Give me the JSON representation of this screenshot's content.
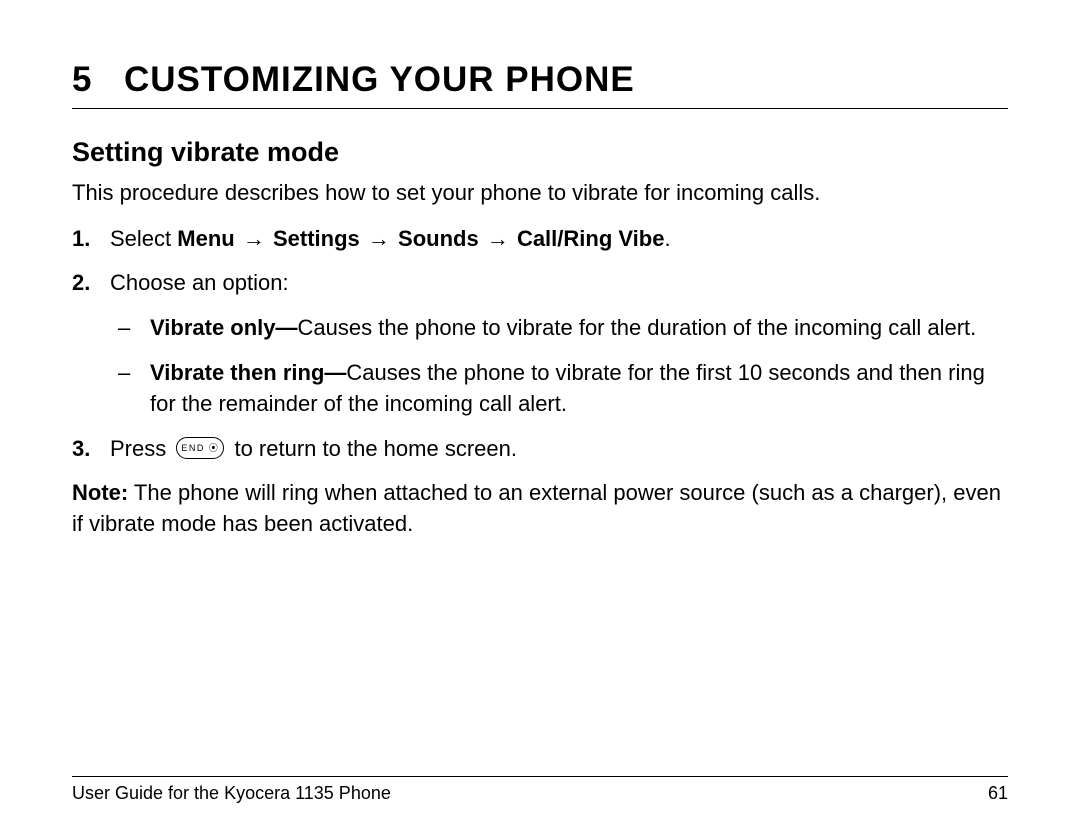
{
  "chapter": {
    "number": "5",
    "title": "CUSTOMIZING YOUR PHONE"
  },
  "section": {
    "title": "Setting vibrate mode",
    "intro": "This procedure describes how to set your phone to vibrate for incoming calls."
  },
  "steps": {
    "s1_prefix": "Select ",
    "s1_path_menu": "Menu",
    "s1_path_settings": "Settings",
    "s1_path_sounds": "Sounds",
    "s1_path_callring": "Call/Ring Vibe",
    "arrow": "→",
    "s1_suffix": ".",
    "s2_text": "Choose an option:",
    "s2_opt1_label": "Vibrate only—",
    "s2_opt1_text": "Causes the phone to vibrate for the duration of the incoming call alert.",
    "s2_opt2_label": "Vibrate then ring—",
    "s2_opt2_text": "Causes the phone to vibrate for the first 10 seconds and then ring for the remainder of the incoming call alert.",
    "s3_prefix": "Press ",
    "s3_key": "END",
    "s3_key_symbol": "⦿",
    "s3_suffix": " to return to the home screen."
  },
  "note": {
    "label": "Note:",
    "text": " The phone will ring when attached to an external power source (such as a charger), even if vibrate mode has been activated."
  },
  "footer": {
    "guide": "User Guide for the Kyocera 1135 Phone",
    "page": "61"
  }
}
